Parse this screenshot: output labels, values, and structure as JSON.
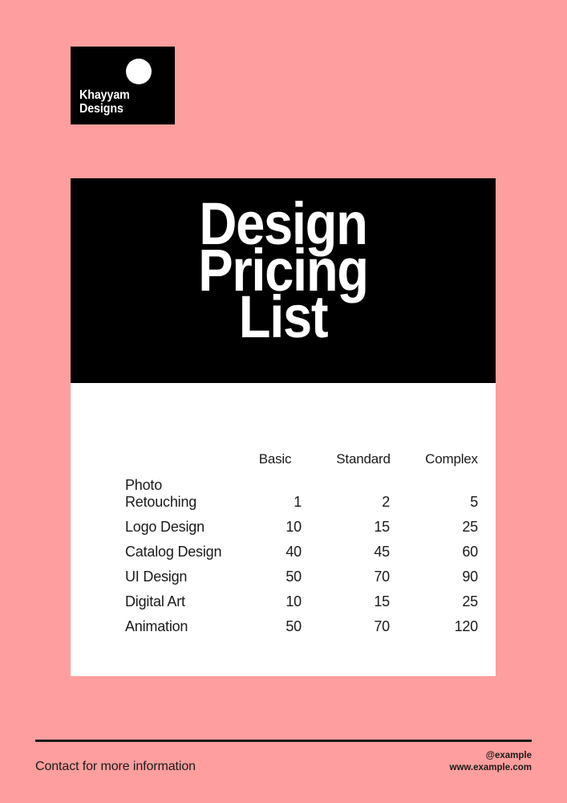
{
  "theme": {
    "background": "#FF9E9E",
    "panel": "#000000",
    "card": "#FFFFFF",
    "text": "#1a1a1a"
  },
  "logo": {
    "line1": "Khayyam",
    "line2": "Designs",
    "mark": "circle-mark"
  },
  "title": {
    "line1": "Design",
    "line2": "Pricing",
    "line3": "List"
  },
  "table": {
    "columns": [
      "",
      "Basic",
      "Standard",
      "Complex"
    ],
    "rows": [
      {
        "service": "Photo Retouching",
        "basic": "1",
        "standard": "2",
        "complex": "5"
      },
      {
        "service": "Logo Design",
        "basic": "10",
        "standard": "15",
        "complex": "25"
      },
      {
        "service": "Catalog Design",
        "basic": "40",
        "standard": "45",
        "complex": "60"
      },
      {
        "service": "UI Design",
        "basic": "50",
        "standard": "70",
        "complex": "90"
      },
      {
        "service": "Digital Art",
        "basic": "10",
        "standard": "15",
        "complex": "25"
      },
      {
        "service": "Animation",
        "basic": "50",
        "standard": "70",
        "complex": "120"
      }
    ]
  },
  "footer": {
    "contact": "Contact for more information",
    "handle": "@example",
    "website": "www.example.com"
  }
}
